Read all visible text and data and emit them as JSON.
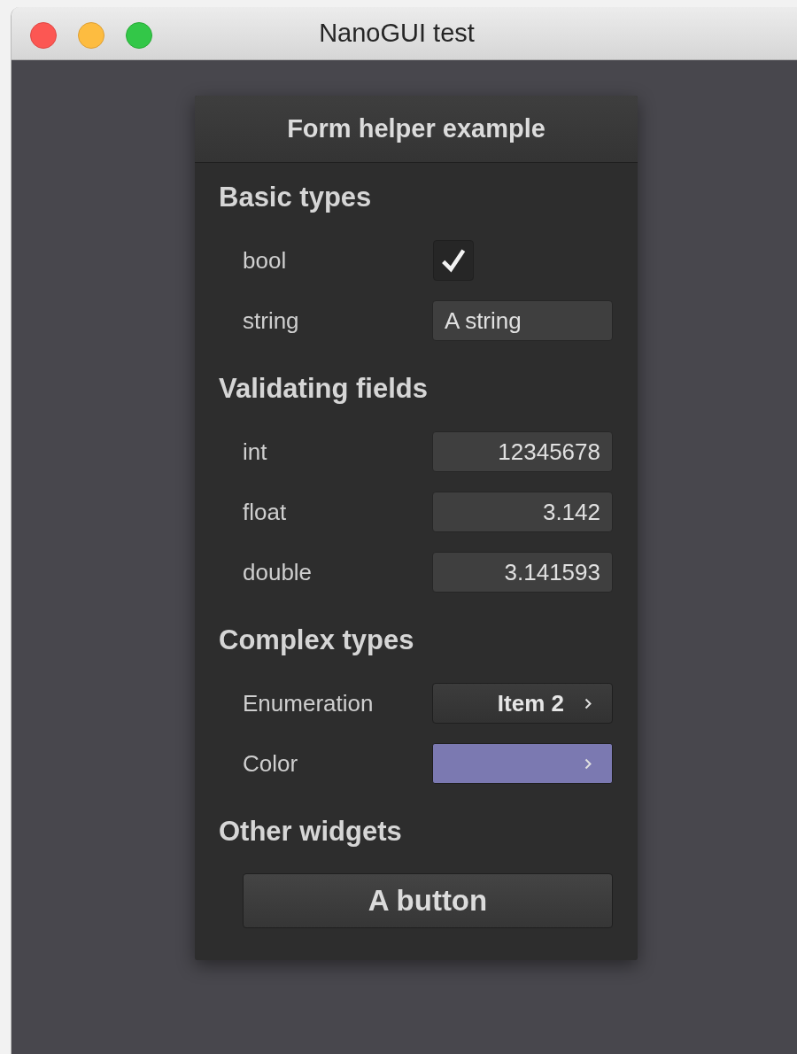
{
  "window": {
    "title": "NanoGUI test"
  },
  "panel": {
    "title": "Form helper example",
    "sections": [
      {
        "title": "Basic types",
        "rows": [
          {
            "kind": "checkbox",
            "label": "bool",
            "checked": true
          },
          {
            "kind": "text",
            "label": "string",
            "value": "A string"
          }
        ]
      },
      {
        "title": "Validating fields",
        "rows": [
          {
            "kind": "number",
            "label": "int",
            "value": "12345678"
          },
          {
            "kind": "number",
            "label": "float",
            "value": "3.142"
          },
          {
            "kind": "number",
            "label": "double",
            "value": "3.141593"
          }
        ]
      },
      {
        "title": "Complex types",
        "rows": [
          {
            "kind": "dropdown",
            "label": "Enumeration",
            "value": "Item 2"
          },
          {
            "kind": "color",
            "label": "Color",
            "color": "#7b79b1"
          }
        ]
      },
      {
        "title": "Other widgets",
        "rows": [
          {
            "kind": "button",
            "label": "A button"
          }
        ]
      }
    ]
  }
}
